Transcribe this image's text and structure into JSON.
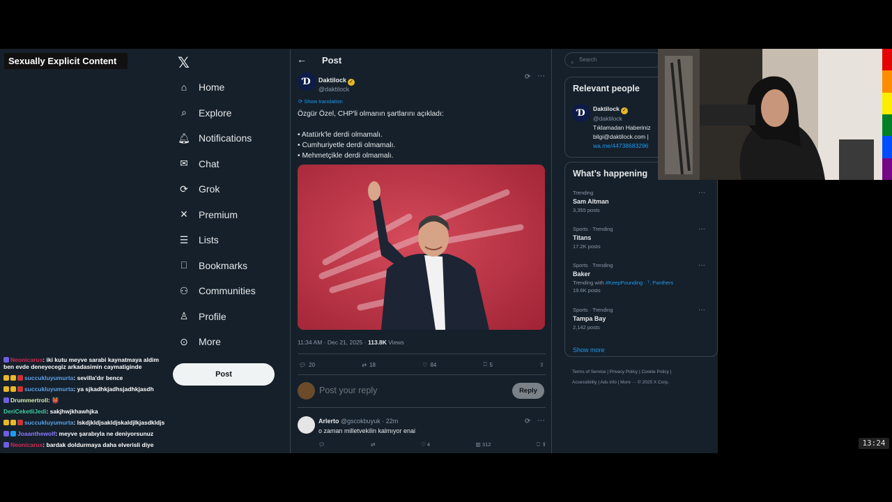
{
  "overlay": {
    "content_warning": "Sexually Explicit Content",
    "clock": "13:24"
  },
  "chat": [
    {
      "user": "Neonicarus",
      "color": "#d12b56",
      "badges": [
        "#6f5fe0"
      ],
      "message": "iki kutu meyve sarabi kaynatmaya aldim ben evde deneyecegiz arkadasimin caymatiginde"
    },
    {
      "user": "succukluyumurta",
      "color": "#5da0e6",
      "badges": [
        "#e8b829",
        "#e8b829",
        "#c33"
      ],
      "message": "sevilla'dır bence"
    },
    {
      "user": "succukluyumurta",
      "color": "#5da0e6",
      "badges": [
        "#e8b829",
        "#e8b829",
        "#c33"
      ],
      "message": "ya sjkadhkjadhsjadhkjasdh"
    },
    {
      "user": "Drummertroll",
      "color": "#d6f0b0",
      "badges": [
        "#6f5fe0"
      ],
      "message": "👹"
    },
    {
      "user": "DeriCeketliJedi",
      "color": "#3ecf9d",
      "badges": [],
      "message": "sakjhwjkhawhjka"
    },
    {
      "user": "succukluyumurta",
      "color": "#5da0e6",
      "badges": [
        "#e8b829",
        "#e8b829",
        "#c33"
      ],
      "message": "lskdjkldjsakldjskaldjlkjasdkldjs"
    },
    {
      "user": "Joaanthewolf",
      "color": "#8f7bff",
      "badges": [
        "#6f5fe0",
        "#1d9bf0"
      ],
      "message": "meyve şarabıyla ne deniyorsunuz"
    },
    {
      "user": "Neonicarus",
      "color": "#d12b56",
      "badges": [
        "#6f5fe0"
      ],
      "message": "bardak doldurmaya daha elverisli diye"
    }
  ],
  "nav": {
    "items": [
      {
        "label": "Home",
        "icon": "home-icon"
      },
      {
        "label": "Explore",
        "icon": "search-icon"
      },
      {
        "label": "Notifications",
        "icon": "bell-icon"
      },
      {
        "label": "Chat",
        "icon": "mail-icon"
      },
      {
        "label": "Grok",
        "icon": "grok-icon"
      },
      {
        "label": "Premium",
        "icon": "x-icon"
      },
      {
        "label": "Lists",
        "icon": "list-icon"
      },
      {
        "label": "Bookmarks",
        "icon": "bookmark-icon"
      },
      {
        "label": "Communities",
        "icon": "communities-icon"
      },
      {
        "label": "Profile",
        "icon": "person-icon"
      },
      {
        "label": "More",
        "icon": "more-icon"
      }
    ],
    "post_label": "Post"
  },
  "main": {
    "header_title": "Post",
    "tweet": {
      "author_name": "Daktilock",
      "author_handle": "@daktilock",
      "show_translation": "Show translation",
      "text": "Özgür Özel, CHP'li olmanın şartlarını açıkladı:\n\n• Atatürk'le derdi olmamalı.\n• Cumhuriyetle derdi olmamalı.\n• Mehmetçikle derdi olmamalı.",
      "timestamp": "11:34 AM · Dec 21, 2025 · ",
      "views_count": "113.8K",
      "views_label": " Views",
      "replies": "20",
      "reposts": "18",
      "likes": "84",
      "bookmarks": "5"
    },
    "reply_placeholder": "Post your reply",
    "reply_button": "Reply",
    "comment": {
      "name": "Arlerto",
      "handle_time": "@gscokbuyuk · 22m",
      "text": "o zaman milletvekilin kalmıyor enai",
      "views": "312"
    }
  },
  "sidebar": {
    "search_placeholder": "Search",
    "relevant_title": "Relevant people",
    "relevant_person": {
      "name": "Daktilock",
      "handle": "@daktilock",
      "bio1": "Tıklamadan Haberiniz",
      "bio2": "bilgi@daktilock.com |",
      "bio3": "wa.me/44738683296"
    },
    "happening_title": "What’s happening",
    "trends": [
      {
        "category": "Trending",
        "name": "Sam Altman",
        "posts": "3,355 posts"
      },
      {
        "category": "Sports · Trending",
        "name": "Titans",
        "posts": "17.2K posts"
      },
      {
        "category": "Sports · Trending",
        "name": "Baker",
        "with_label": "Trending with ",
        "with_links": "#KeepPounding · ᵀ, Panthers",
        "posts": "19.6K posts"
      },
      {
        "category": "Sports · Trending",
        "name": "Tampa Bay",
        "posts": "2,142 posts"
      }
    ],
    "show_more": "Show more",
    "footer_line1": "Terms of Service  |  Privacy Policy  |  Cookie Policy  |",
    "footer_line2": "Accessibility  |  Ads info  |  More ···  © 2025 X Corp."
  },
  "colors": {
    "bg": "#15202b",
    "border": "#38444d",
    "accent": "#1d9bf0",
    "muted": "#8b98a5"
  }
}
